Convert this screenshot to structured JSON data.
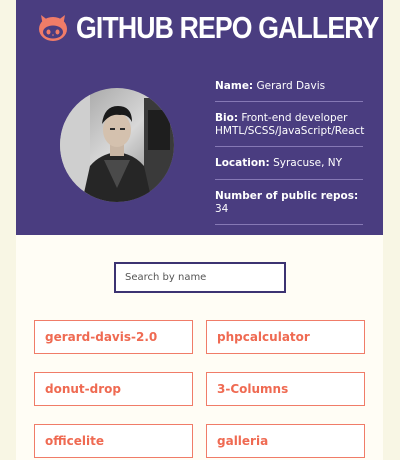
{
  "site": {
    "title": "GITHUB REPO GALLERY",
    "logo_icon": "octocat-icon"
  },
  "profile": {
    "avatar_alt": "profile-photo",
    "name_label": "Name:",
    "name_value": "Gerard Davis",
    "bio_label": "Bio:",
    "bio_value": "Front-end developer HMTL/SCSS/JavaScript/React",
    "location_label": "Location:",
    "location_value": "Syracuse, NY",
    "repos_label": "Number of public repos:",
    "repos_value": "34"
  },
  "search": {
    "placeholder": "Search by name",
    "value": ""
  },
  "repos": [
    "gerard-davis-2.0",
    "phpcalculator",
    "donut-drop",
    "3-Columns",
    "officelite",
    "galleria"
  ],
  "colors": {
    "header_bg": "#4a3d80",
    "accent": "#ef6a52",
    "page_bg": "#f8f6e4",
    "content_bg": "#fffdf5"
  }
}
